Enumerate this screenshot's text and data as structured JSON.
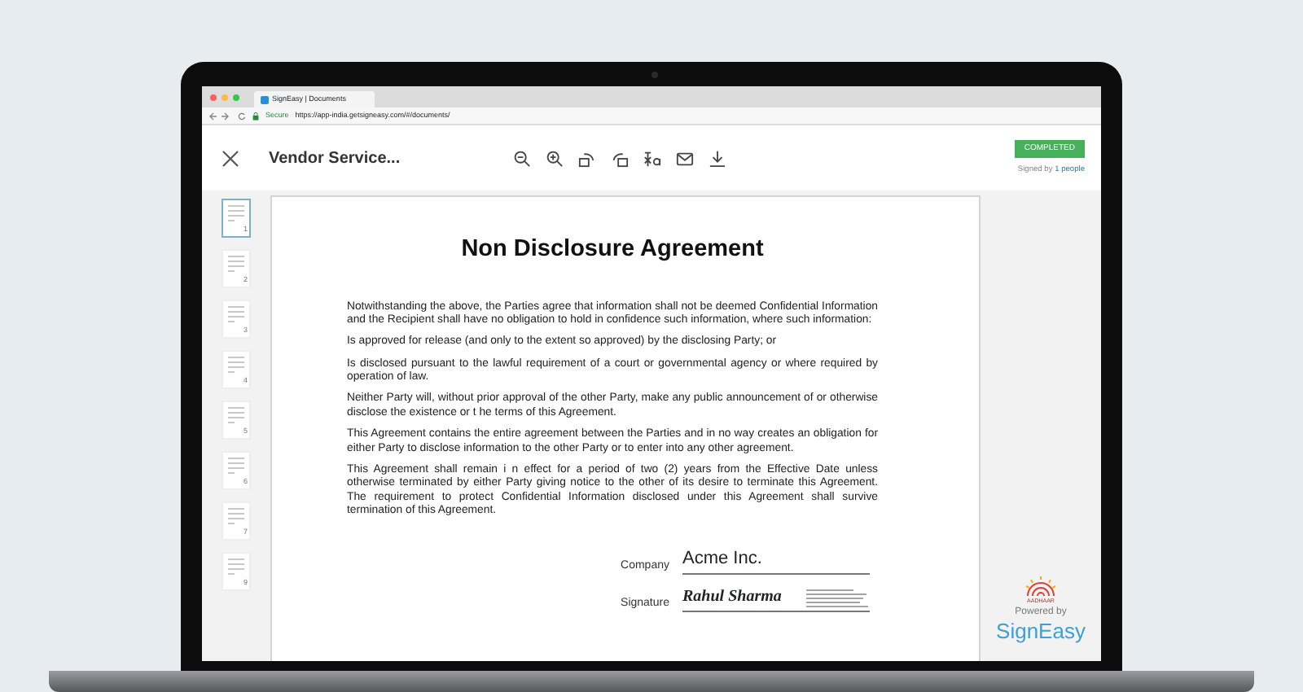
{
  "browser": {
    "tab_title": "SignEasy | Documents",
    "url_secure": "Secure",
    "url": "https://app-india.getsigneasy.com/#/documents/"
  },
  "toolbar": {
    "title": "Vendor Service...",
    "status_badge": "COMPLETED",
    "signed_by_prefix": "Signed by",
    "signed_by_link": "1 people"
  },
  "thumbnails": [
    {
      "label": "1",
      "selected": true
    },
    {
      "label": "2",
      "selected": false
    },
    {
      "label": "3",
      "selected": false
    },
    {
      "label": "4",
      "selected": false
    },
    {
      "label": "5",
      "selected": false
    },
    {
      "label": "6",
      "selected": false
    },
    {
      "label": "7",
      "selected": false
    },
    {
      "label": "9",
      "selected": false
    }
  ],
  "document": {
    "title": "Non Disclosure Agreement",
    "paragraphs": [
      "Notwithstanding the above, the Parties agree that information shall not be deemed Confidential Information and the Recipient shall have no obligation to hold in confidence such information, where such information:",
      "Is approved for release (and only to the extent so approved) by the disclosing Party; or",
      "Is disclosed pursuant to the lawful requirement of a court or governmental agency or where required by operation of law.",
      "Neither Party will, without prior approval of the other Party, make any public announcement of or otherwise disclose the existence or t he terms of this Agreement.",
      "This Agreement contains the entire agreement between the Parties and in no way creates an obligation for either Party to disclose information to the other Party or to enter into any other agreement.",
      "This Agreement shall remain i n effect for a period of two (2) years from the Effective Date unless otherwise terminated by either Party giving notice to the other of its desire to terminate this Agreement. The requirement to protect Confidential Information disclosed under this Agreement shall survive termination of this Agreement."
    ],
    "fields": [
      {
        "label": "Company",
        "value": "Acme Inc.",
        "kind": "text"
      },
      {
        "label": "Signature",
        "value": "Rahul Sharma",
        "kind": "signature"
      }
    ]
  },
  "branding": {
    "aadhaar": "AADHAAR",
    "powered_by": "Powered by",
    "brand": "SignEasy"
  }
}
